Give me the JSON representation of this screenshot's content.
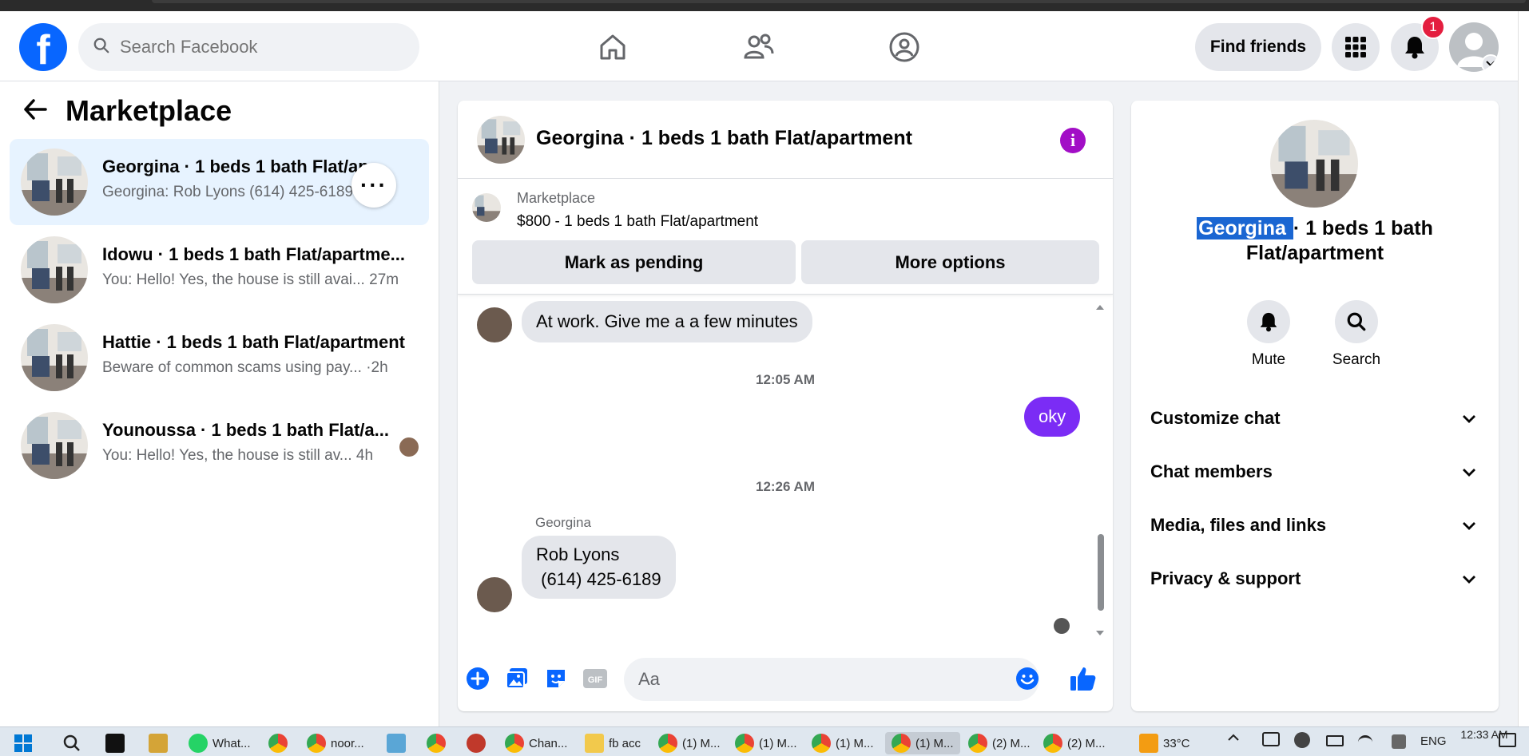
{
  "topbar": {
    "search_placeholder": "Search Facebook",
    "find_friends_label": "Find friends",
    "notification_count": "1",
    "brand_color": "#0866ff"
  },
  "left_panel": {
    "title": "Marketplace",
    "conversations": [
      {
        "name": "Georgina · 1 beds 1 bath Flat/ap…",
        "preview": "Georgina: Rob Lyons (614) 425-6189",
        "time": ""
      },
      {
        "name": "Idowu · 1 beds 1 bath Flat/apartme...",
        "preview": "You: Hello! Yes, the house is still avai...",
        "time": "27m"
      },
      {
        "name": "Hattie · 1 beds 1 bath Flat/apartment",
        "preview": "Beware of common scams using pay...",
        "time": "·2h"
      },
      {
        "name": "Younoussa · 1 beds 1 bath Flat/a...",
        "preview": "You: Hello! Yes, the house is still av...",
        "time": "4h"
      }
    ]
  },
  "chat": {
    "title": "Georgina · 1 beds 1 bath Flat/apartment",
    "listing_label": "Marketplace",
    "listing_price": "$800 - 1 beds 1 bath Flat/apartment",
    "mark_pending_label": "Mark as pending",
    "more_options_label": "More options",
    "messages": {
      "msg1": "At work. Give me a a few minutes",
      "ts1": "12:05 AM",
      "msg2": "oky",
      "ts2": "12:26 AM",
      "sender3": "Georgina",
      "msg3_line1": "Rob Lyons",
      "msg3_line2": " (614) 425-6189"
    },
    "composer_placeholder": "Aa",
    "accent_color": "#7b2cf5"
  },
  "right_panel": {
    "name_highlight": "Georgina ",
    "name_rest": "· 1 beds 1 bath Flat/apartment",
    "mute_label": "Mute",
    "search_label": "Search",
    "sections": [
      "Customize chat",
      "Chat members",
      "Media, files and links",
      "Privacy & support"
    ]
  },
  "taskbar": {
    "items": [
      "What...",
      "noor...",
      "Chan...",
      "fb acc",
      "(1) M...",
      "(1) M...",
      "(1) M...",
      "(1) M...",
      "(2) M...",
      "(2) M..."
    ],
    "temperature": "33°C",
    "language": "ENG",
    "clock": "12:33 AM"
  }
}
